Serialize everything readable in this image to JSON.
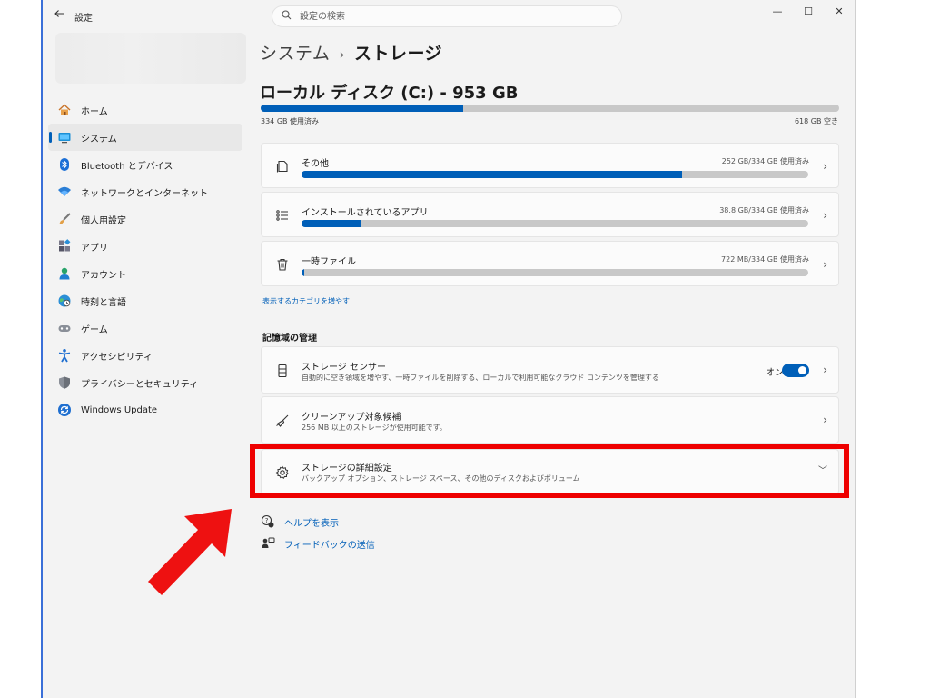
{
  "window": {
    "title": "設定",
    "search_placeholder": "設定の検索",
    "controls": {
      "minimize": "—",
      "maximize": "☐",
      "close": "✕"
    }
  },
  "sidebar": {
    "items": [
      {
        "label": "ホーム",
        "icon": "home-icon",
        "selected": false
      },
      {
        "label": "システム",
        "icon": "system-icon",
        "selected": true
      },
      {
        "label": "Bluetooth とデバイス",
        "icon": "bluetooth-icon",
        "selected": false
      },
      {
        "label": "ネットワークとインターネット",
        "icon": "network-icon",
        "selected": false
      },
      {
        "label": "個人用設定",
        "icon": "brush-icon",
        "selected": false
      },
      {
        "label": "アプリ",
        "icon": "apps-icon",
        "selected": false
      },
      {
        "label": "アカウント",
        "icon": "account-icon",
        "selected": false
      },
      {
        "label": "時刻と言語",
        "icon": "globe-clock-icon",
        "selected": false
      },
      {
        "label": "ゲーム",
        "icon": "gamepad-icon",
        "selected": false
      },
      {
        "label": "アクセシビリティ",
        "icon": "accessibility-icon",
        "selected": false
      },
      {
        "label": "プライバシーとセキュリティ",
        "icon": "shield-icon",
        "selected": false
      },
      {
        "label": "Windows Update",
        "icon": "windows-update-icon",
        "selected": false
      }
    ]
  },
  "breadcrumb": {
    "parent": "システム",
    "separator": "›",
    "current": "ストレージ"
  },
  "disk": {
    "title": "ローカル ディスク (C:) - 953 GB",
    "used_label": "334 GB 使用済み",
    "free_label": "618 GB 空き",
    "used_percent": 35
  },
  "categories": [
    {
      "title": "その他",
      "size": "252 GB/334 GB 使用済み",
      "percent": 75,
      "icon": "document-icon"
    },
    {
      "title": "インストールされているアプリ",
      "size": "38.8 GB/334 GB 使用済み",
      "percent": 11.6,
      "icon": "list-icon"
    },
    {
      "title": "一時ファイル",
      "size": "722 MB/334 GB 使用済み",
      "percent": 0.5,
      "icon": "trash-icon"
    }
  ],
  "show_more_link": "表示するカテゴリを増やす",
  "management": {
    "section_title": "記憶域の管理",
    "storage_sense": {
      "title": "ストレージ センサー",
      "subtitle": "自動的に空き領域を増やす、一時ファイルを削除する、ローカルで利用可能なクラウド コンテンツを管理する",
      "toggle_label": "オン",
      "toggle_on": true
    },
    "cleanup": {
      "title": "クリーンアップ対象候補",
      "subtitle": "256 MB 以上のストレージが使用可能です。"
    },
    "advanced": {
      "title": "ストレージの詳細設定",
      "subtitle": "バックアップ オプション、ストレージ スペース、その他のディスクおよびボリューム"
    }
  },
  "help": {
    "get_help": "ヘルプを表示",
    "feedback": "フィードバックの送信"
  },
  "colors": {
    "accent": "#005fb8",
    "highlight": "#ee0000",
    "arrow": "#ee1111"
  }
}
